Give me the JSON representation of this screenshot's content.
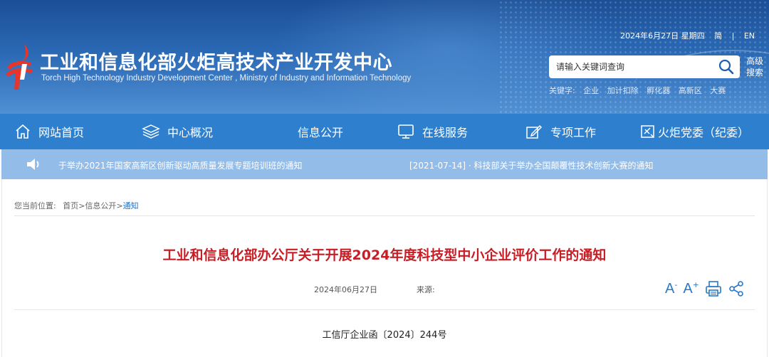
{
  "header": {
    "site_title": "工业和信息化部火炬高技术产业开发中心",
    "site_subtitle": "Torch High Technology Industry Development Center , Ministry of Industry and Information Technology",
    "date": "2024年6月27日 星期四",
    "lang_simplified": "简",
    "lang_separator": "|",
    "lang_english": "EN",
    "search": {
      "placeholder": "请输入关键词查询",
      "advanced_label": "高级搜索"
    },
    "keywords_label": "关键字:",
    "keywords": [
      "企业",
      "加计扣除",
      "孵化器",
      "高新区",
      "大赛"
    ]
  },
  "nav": {
    "items": [
      {
        "label": "网站首页",
        "icon": "home-icon"
      },
      {
        "label": "中心概况",
        "icon": "layers-icon"
      },
      {
        "label": "信息公开",
        "icon": ""
      },
      {
        "label": "在线服务",
        "icon": "monitor-icon"
      },
      {
        "label": "专项工作",
        "icon": "pen-icon"
      },
      {
        "label": "火炬党委（纪委）",
        "icon": "party-icon"
      }
    ]
  },
  "notice": {
    "messages": [
      "于举办2021年国家高新区创新驱动高质量发展专题培训班的通知",
      "[2021-07-14] · 科技部关于举办全国颠覆性技术创新大赛的通知"
    ]
  },
  "breadcrumb": {
    "prefix": "您当前位置:",
    "home": "首页",
    "sep1": ">",
    "section": "信息公开",
    "sep2": ">",
    "current": "通知"
  },
  "article": {
    "title": "工业和信息化部办公厅关于开展2024年度科技型中小企业评价工作的通知",
    "date": "2024年06月27日",
    "source_label": "来源:",
    "doc_number": "工信厅企业函〔2024〕244号"
  },
  "tools": {
    "font_decrease_glyph": "A",
    "font_decrease_sup": "-",
    "font_increase_glyph": "A",
    "font_increase_sup": "+",
    "print_icon": "print-icon",
    "share_icon": "share-icon"
  },
  "colors": {
    "nav_blue": "#2e7fce",
    "notice_blue": "#93bde8",
    "title_red": "#c81d25",
    "accent_blue": "#2a78c8"
  }
}
